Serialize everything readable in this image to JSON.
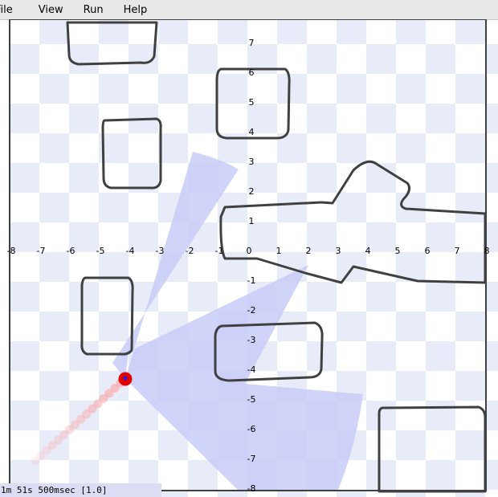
{
  "menu": [
    "File",
    "View",
    "Run",
    "Help"
  ],
  "status": "1m 51s 500msec [1.0]",
  "axis": {
    "x_ticks": [
      "-8",
      "-7",
      "-6",
      "-5",
      "-4",
      "-3",
      "-2",
      "-1",
      "0",
      "1",
      "2",
      "3",
      "4",
      "5",
      "6",
      "7",
      "8"
    ],
    "y_ticks": [
      "7",
      "6",
      "5",
      "4",
      "3",
      "2",
      "1",
      "-1",
      "-2",
      "-3",
      "-4",
      "-5",
      "-6",
      "-7",
      "-8"
    ]
  },
  "colors": {
    "checker_light": "#ffffff",
    "checker_dark": "#e8ecf9",
    "sensor": "#c8cdf8",
    "obstacle": "#404040",
    "robot": "#e00000",
    "robot_dot": "#2020e0",
    "trail": "#ff9a9a"
  }
}
